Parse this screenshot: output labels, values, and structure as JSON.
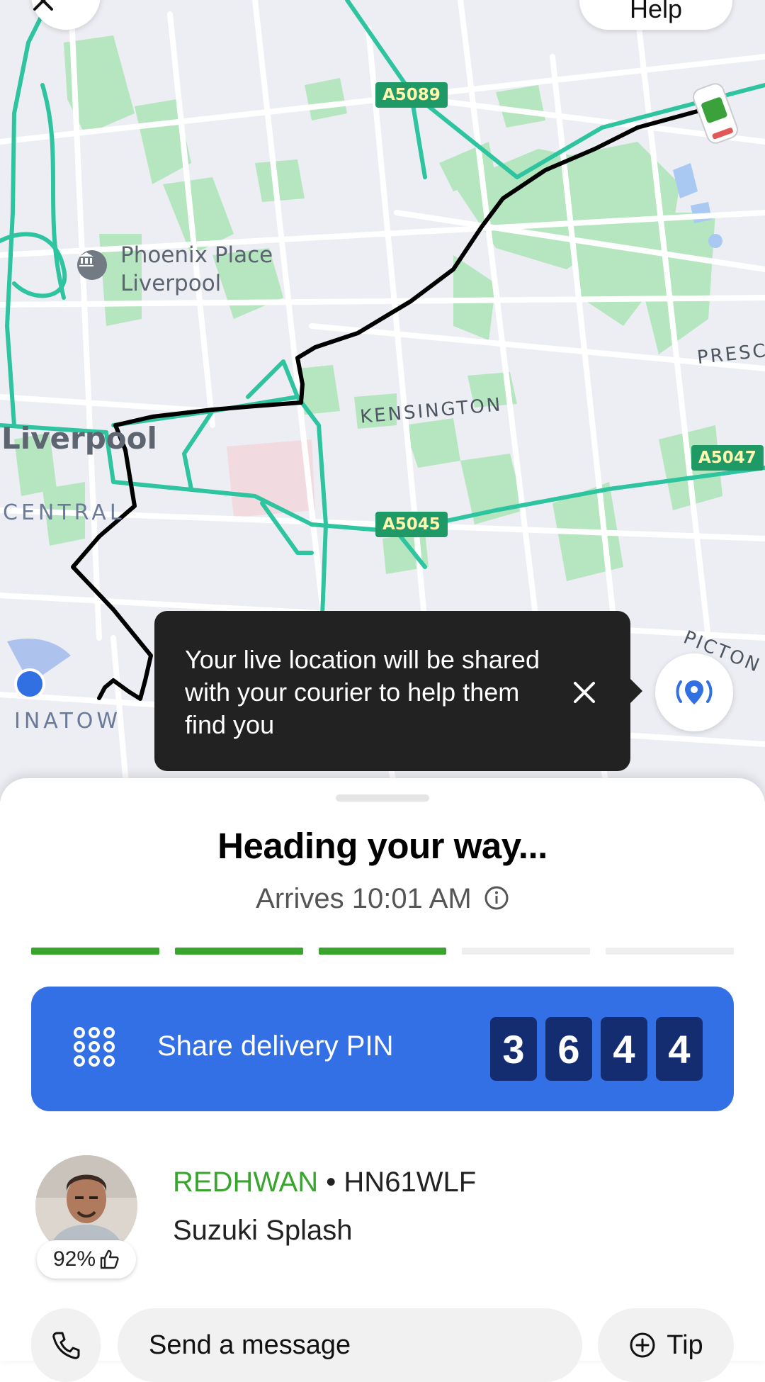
{
  "map": {
    "labels": {
      "poi": "Phoenix Place\nLiverpool",
      "poi_line1": "Phoenix Place",
      "poi_line2": "Liverpool",
      "city": "Liverpool",
      "central": "CENTRAL",
      "kensington": "KENSINGTON",
      "preston": "PRESC",
      "picton": "PICTON",
      "inatow": "INATOW"
    },
    "roads": [
      "A5089",
      "A5045",
      "A5047"
    ]
  },
  "top": {
    "help_label": "Help"
  },
  "tooltip": {
    "text": "Your live location will be shared with your courier to help them find you"
  },
  "status": {
    "heading": "Heading your way...",
    "arrives": "Arrives 10:01 AM",
    "progress_segments": 5,
    "progress_completed": 3
  },
  "pin": {
    "label": "Share delivery PIN",
    "digits": [
      "3",
      "6",
      "4",
      "4"
    ]
  },
  "driver": {
    "name": "REDHWAN",
    "separator": " • ",
    "plate": "HN61WLF",
    "car": "Suzuki Splash",
    "rating": "92%"
  },
  "actions": {
    "message_label": "Send a message",
    "tip_label": "Tip"
  },
  "colors": {
    "accent_green": "#39a52e",
    "pin_blue": "#3470e5",
    "pin_digit_bg": "#142d70",
    "route": "#000000",
    "road_green": "#2ec4a0",
    "park": "#a8e2b4"
  }
}
